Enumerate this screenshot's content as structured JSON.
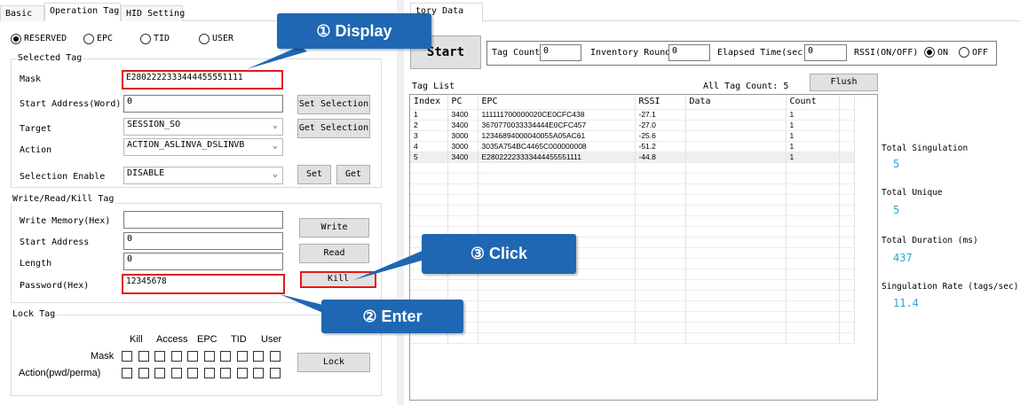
{
  "tabs": [
    {
      "label": "Basic",
      "active": false
    },
    {
      "label": "Operation Tag",
      "active": true
    },
    {
      "label": "HID Setting",
      "active": false
    }
  ],
  "inventory_tab": {
    "label": "tory Data"
  },
  "radio_options": [
    {
      "label": "RESERVED",
      "selected": true
    },
    {
      "label": "EPC",
      "selected": false
    },
    {
      "label": "TID",
      "selected": false
    },
    {
      "label": "USER",
      "selected": false
    }
  ],
  "selected_tag": {
    "title": "Selected Tag",
    "mask_label": "Mask",
    "mask_value": "E2802222333444455551111",
    "start_address_label": "Start Address(Word)",
    "start_address_value": "0",
    "target_label": "Target",
    "target_value": "SESSION_SO",
    "action_label": "Action",
    "action_value": "ACTION_ASLINVA_DSLINVB",
    "selection_enable_label": "Selection Enable",
    "selection_enable_value": "DISABLE",
    "set_selection_button": "Set Selection",
    "get_selection_button": "Get Selection",
    "set_button": "Set",
    "get_button": "Get"
  },
  "write_read_kill": {
    "title": "Write/Read/Kill Tag",
    "write_memory_label": "Write Memory(Hex)",
    "write_memory_value": "",
    "start_address_label": "Start Address",
    "start_address_value": "0",
    "length_label": "Length",
    "length_value": "0",
    "password_label": "Password(Hex)",
    "password_value": "12345678",
    "write_button": "Write",
    "read_button": "Read",
    "kill_button": "Kill"
  },
  "lock_tag": {
    "title": "Lock Tag",
    "columns": [
      "Kill",
      "Access",
      "EPC",
      "TID",
      "User"
    ],
    "mask_label": "Mask",
    "action_label": "Action(pwd/perma)",
    "lock_button": "Lock"
  },
  "inventory": {
    "start_button": "Start",
    "tag_count_label": "Tag Count",
    "tag_count_value": "0",
    "inventory_round_label": "Inventory Round",
    "inventory_round_value": "0",
    "elapsed_time_label": "Elapsed Time(sec)",
    "elapsed_time_value": "0",
    "rssi_label": "RSSI(ON/OFF)",
    "rssi_on_label": "ON",
    "rssi_off_label": "OFF",
    "rssi_on": true,
    "tag_list_label": "Tag List",
    "all_tag_count_label": "All Tag Count:",
    "all_tag_count_value": "5",
    "flush_button": "Flush",
    "columns": [
      "Index",
      "PC",
      "EPC",
      "RSSI",
      "Data",
      "Count"
    ],
    "rows": [
      {
        "index": "1",
        "pc": "3400",
        "epc": "111111700000020CE0CFC438",
        "rssi": "-27.1",
        "data": "",
        "count": "1"
      },
      {
        "index": "2",
        "pc": "3400",
        "epc": "3670770033334444E0CFC457",
        "rssi": "-27.0",
        "data": "",
        "count": "1"
      },
      {
        "index": "3",
        "pc": "3000",
        "epc": "12346894000040055A05AC61",
        "rssi": "-25.6",
        "data": "",
        "count": "1"
      },
      {
        "index": "4",
        "pc": "3000",
        "epc": "3035A754BC4465C000000008",
        "rssi": "-51.2",
        "data": "",
        "count": "1"
      },
      {
        "index": "5",
        "pc": "3400",
        "epc": "E28022223333444455551111",
        "rssi": "-44.8",
        "data": "",
        "count": "1"
      }
    ]
  },
  "stats": {
    "total_singulation_label": "Total Singulation",
    "total_singulation_value": "5",
    "total_unique_label": "Total Unique",
    "total_unique_value": "5",
    "total_duration_label": "Total Duration (ms)",
    "total_duration_value": "437",
    "singulation_rate_label": "Singulation Rate (tags/sec)",
    "singulation_rate_value": "11.4"
  },
  "callouts": {
    "display": "① Display",
    "enter": "② Enter",
    "click": "③ Click"
  },
  "colors": {
    "callout_blue": "#1f67b3",
    "highlight_red": "#e0191b",
    "stat_cyan": "#2aa7c9"
  }
}
